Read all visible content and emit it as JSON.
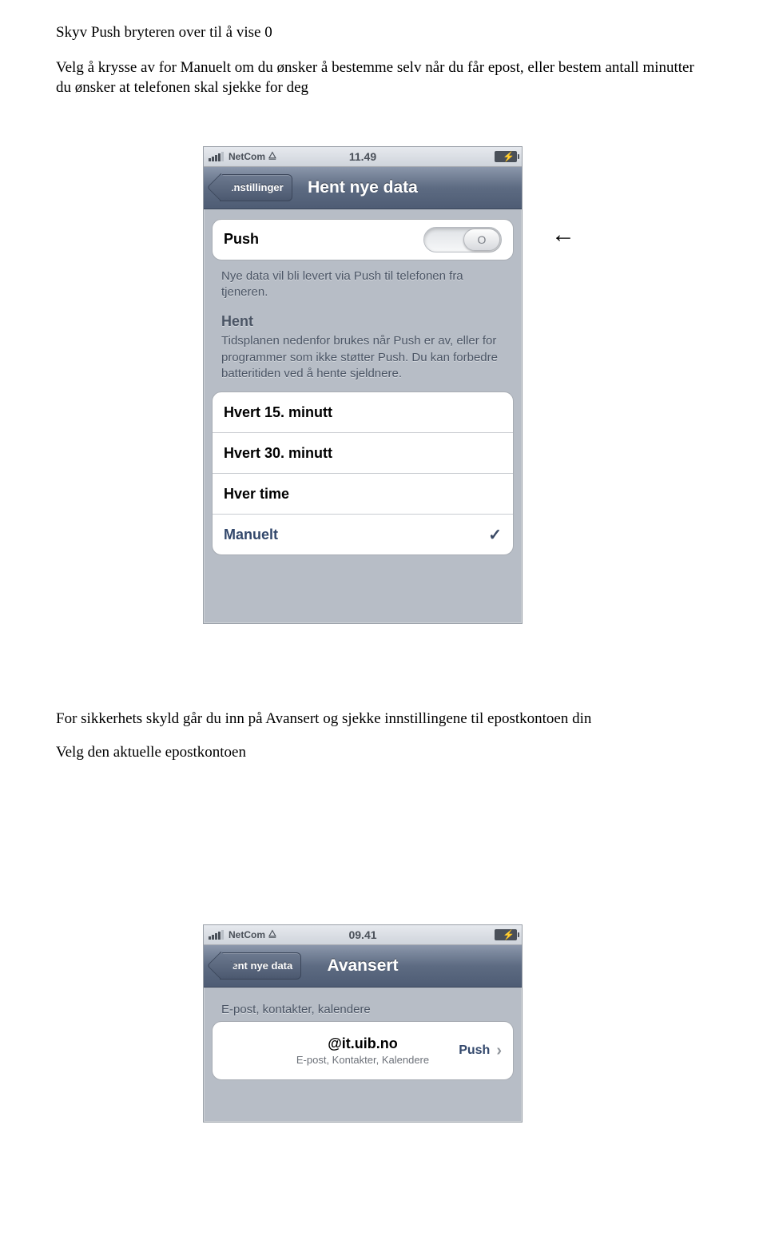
{
  "doc": {
    "para1": "Skyv Push bryteren over til å vise 0",
    "para2": "Velg å krysse av for Manuelt om du ønsker å bestemme selv når du får epost, eller bestem antall minutter du ønsker at telefonen skal sjekke for deg",
    "arrow": "←",
    "para3": "For sikkerhets skyld går du inn på Avansert og sjekke innstillingene til epostkontoen din",
    "para4": "Velg den aktuelle epostkontoen"
  },
  "phone1": {
    "carrier": "NetCom",
    "time": "11.49",
    "back": "Innstillinger",
    "title": "Hent nye data",
    "push_label": "Push",
    "push_knob": "O",
    "push_desc": "Nye data vil bli levert via Push til telefonen fra tjeneren.",
    "hent_header": "Hent",
    "hent_desc": "Tidsplanen nedenfor brukes når Push er av, eller for programmer som ikke støtter Push. Du kan forbedre batteritiden ved å hente sjeldnere.",
    "options": [
      "Hvert 15. minutt",
      "Hvert 30. minutt",
      "Hver time",
      "Manuelt"
    ],
    "selected_index": 3,
    "checkmark": "✓"
  },
  "phone2": {
    "carrier": "NetCom",
    "time": "09.41",
    "back": "Hent nye data",
    "title": "Avansert",
    "section": "E-post, kontakter, kalendere",
    "account_title": "@it.uib.no",
    "account_sub": "E-post, Kontakter, Kalendere",
    "account_value": "Push",
    "chevron": "›"
  }
}
